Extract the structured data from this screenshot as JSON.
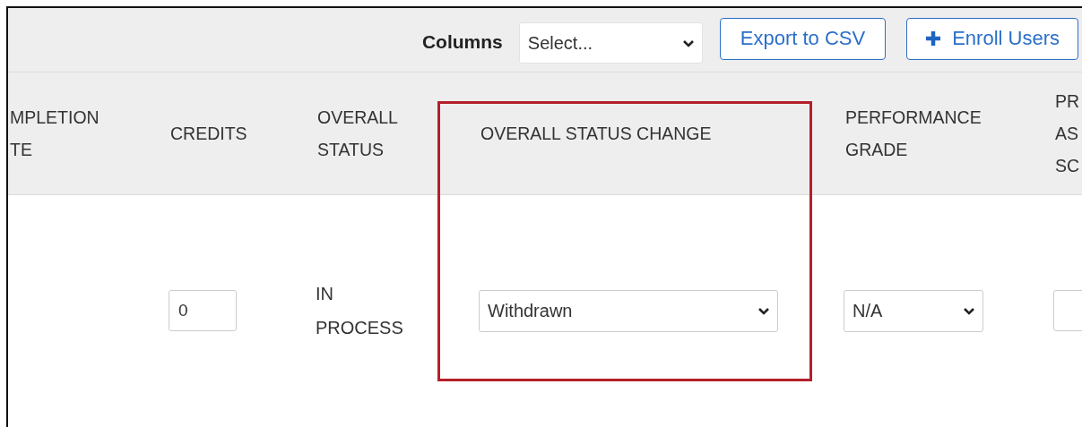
{
  "toolbar": {
    "columns_label": "Columns",
    "columns_select": {
      "value": "Select..."
    },
    "buttons": [
      {
        "kind": "outline",
        "label": "Export to CSV"
      },
      {
        "kind": "add",
        "label": "Enroll Users"
      }
    ]
  },
  "table": {
    "columns": [
      {
        "header": "MPLETION\nTE",
        "highlighted": false
      },
      {
        "header": "CREDITS",
        "highlighted": false
      },
      {
        "header": "OVERALL\nSTATUS",
        "highlighted": false
      },
      {
        "header": "OVERALL STATUS CHANGE",
        "highlighted": true
      },
      {
        "header": "PERFORMANCE\nGRADE",
        "highlighted": false
      },
      {
        "header": "PR\nAS\nSC",
        "highlighted": false
      }
    ],
    "rows": [
      {
        "cells": [
          {
            "kind": "empty"
          },
          {
            "kind": "input",
            "value": "0"
          },
          {
            "kind": "text",
            "value": "IN\nPROCESS"
          },
          {
            "kind": "select",
            "value": "Withdrawn"
          },
          {
            "kind": "select",
            "value": "N/A"
          },
          {
            "kind": "input"
          }
        ]
      }
    ]
  }
}
